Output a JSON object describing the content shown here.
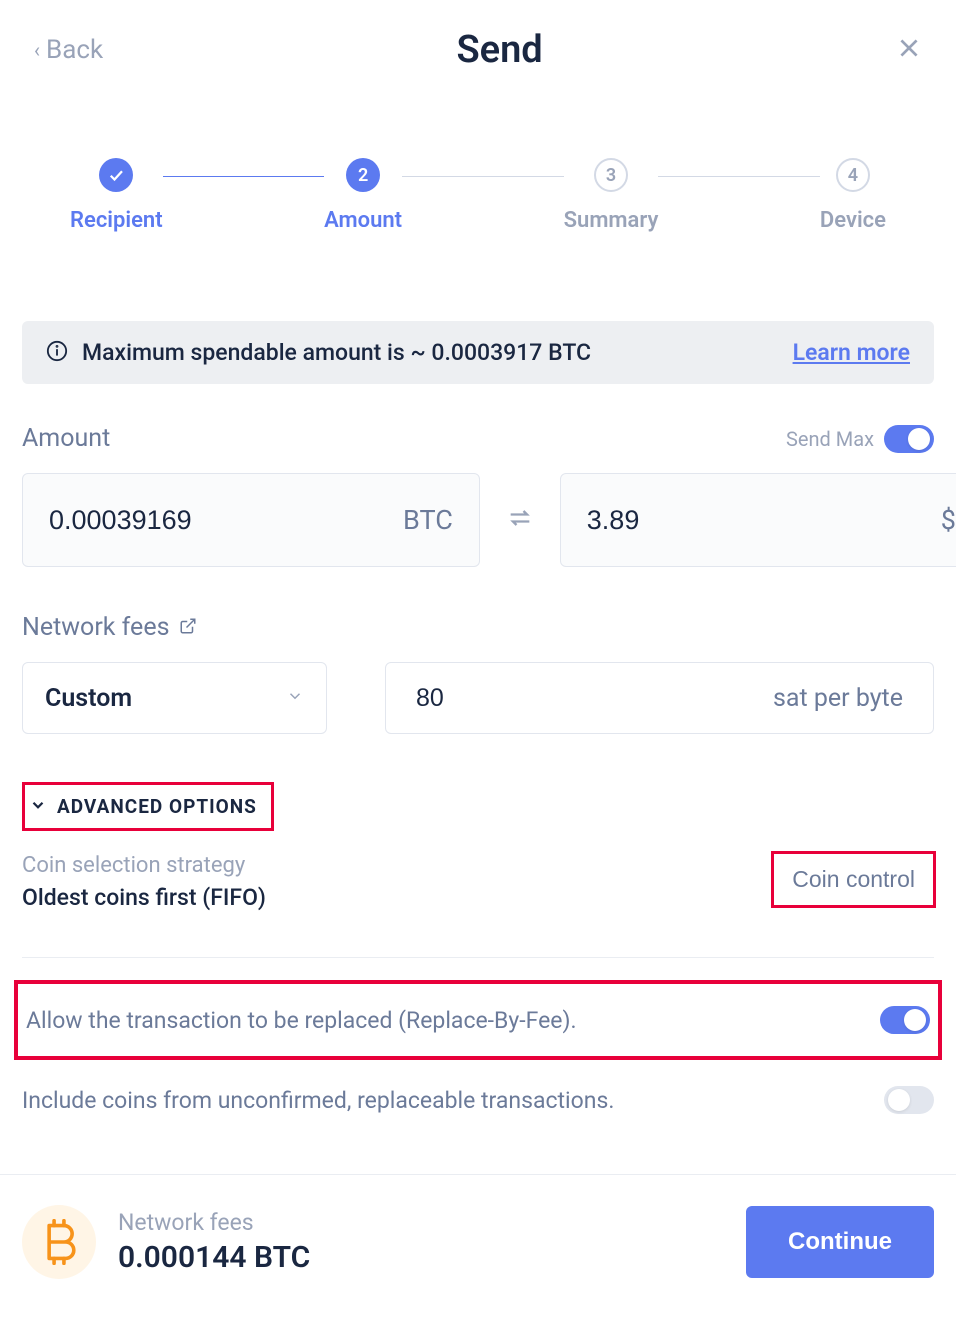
{
  "header": {
    "back": "Back",
    "title": "Send"
  },
  "steps": [
    {
      "label": "Recipient",
      "num": "✓"
    },
    {
      "label": "Amount",
      "num": "2"
    },
    {
      "label": "Summary",
      "num": "3"
    },
    {
      "label": "Device",
      "num": "4"
    }
  ],
  "banner": {
    "text": "Maximum spendable amount is ~ 0.0003917 BTC",
    "learn": "Learn more"
  },
  "amount": {
    "label": "Amount",
    "sendmax": "Send Max",
    "crypto_value": "0.00039169",
    "crypto_unit": "BTC",
    "fiat_value": "3.89",
    "fiat_unit": "$"
  },
  "fees": {
    "label": "Network fees",
    "selected": "Custom",
    "rate_value": "80",
    "rate_unit": "sat per byte"
  },
  "advanced": {
    "toggle_label": "ADVANCED OPTIONS",
    "strategy_label": "Coin selection strategy",
    "strategy_value": "Oldest coins first (FIFO)",
    "coin_control": "Coin control",
    "rbf_label": "Allow the transaction to be replaced (Replace-By-Fee).",
    "unconfirmed_label": "Include coins from unconfirmed, replaceable transactions."
  },
  "footer": {
    "fee_label": "Network fees",
    "fee_value": "0.000144 BTC",
    "continue": "Continue"
  }
}
